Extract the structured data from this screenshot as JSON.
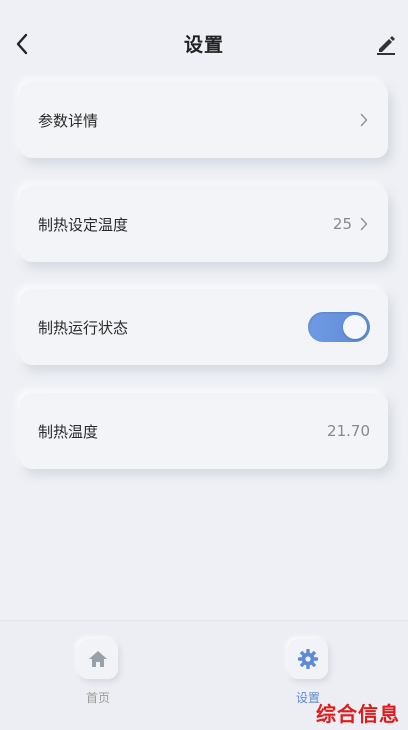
{
  "header": {
    "title": "设置",
    "back_icon": "chevron-left-icon",
    "edit_icon": "pencil-icon"
  },
  "settings": [
    {
      "label": "参数详情",
      "value": "",
      "type": "link"
    },
    {
      "label": "制热设定温度",
      "value": "25",
      "type": "link"
    },
    {
      "label": "制热运行状态",
      "value": "on",
      "type": "toggle"
    },
    {
      "label": "制热温度",
      "value": "21.70",
      "type": "readonly"
    }
  ],
  "nav": {
    "home_label": "首页",
    "settings_label": "设置"
  },
  "watermark": "综合信息",
  "colors": {
    "accent": "#5d8ad7",
    "background": "#eef0f5",
    "watermark": "#e01b1b"
  }
}
